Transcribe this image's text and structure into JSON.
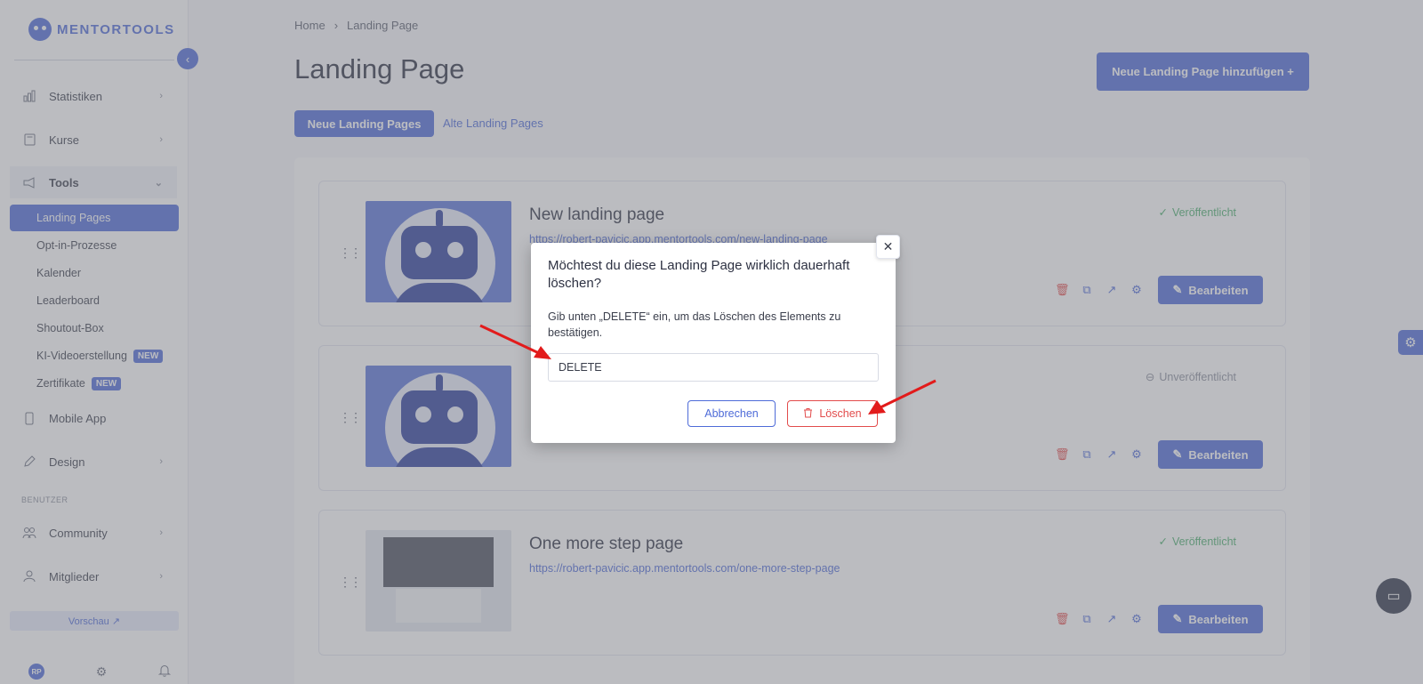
{
  "brand": {
    "name": "MENTORTOOLS"
  },
  "sidebar": {
    "items": [
      {
        "label": "Statistiken",
        "icon": "bar-chart-icon"
      },
      {
        "label": "Kurse",
        "icon": "book-icon"
      },
      {
        "label": "Tools",
        "icon": "megaphone-icon"
      },
      {
        "label": "Mobile App",
        "icon": "phone-icon"
      },
      {
        "label": "Design",
        "icon": "pencil-icon"
      },
      {
        "label": "Community",
        "icon": "people-icon"
      },
      {
        "label": "Mitglieder",
        "icon": "user-icon"
      }
    ],
    "sub_items": [
      {
        "label": "Landing Pages"
      },
      {
        "label": "Opt-in-Prozesse"
      },
      {
        "label": "Kalender"
      },
      {
        "label": "Leaderboard"
      },
      {
        "label": "Shoutout-Box"
      },
      {
        "label": "KI-Videoerstellung",
        "badge": "NEW"
      },
      {
        "label": "Zertifikate",
        "badge": "NEW"
      }
    ],
    "section_label": "BENUTZER",
    "preview_label": "Vorschau ↗",
    "avatar_initials": "RP"
  },
  "breadcrumb": {
    "home": "Home",
    "separator": "›",
    "current": "Landing Page"
  },
  "page": {
    "title": "Landing Page",
    "add_button": "Neue Landing Page hinzufügen  +",
    "tab_new": "Neue Landing Pages",
    "tab_old": "Alte Landing Pages"
  },
  "cards": [
    {
      "title": "New landing page",
      "url": "https://robert-pavicic.app.mentortools.com/new-landing-page",
      "status": "Veröffentlicht",
      "status_type": "published",
      "edit_label": "Bearbeiten"
    },
    {
      "title": "",
      "url": "",
      "status": "Unveröffentlicht",
      "status_type": "unpublished",
      "edit_label": "Bearbeiten"
    },
    {
      "title": "One more step page",
      "url": "https://robert-pavicic.app.mentortools.com/one-more-step-page",
      "status": "Veröffentlicht",
      "status_type": "published",
      "edit_label": "Bearbeiten"
    }
  ],
  "modal": {
    "title": "Möchtest du diese Landing Page wirklich dauerhaft löschen?",
    "description": "Gib unten „DELETE“ ein, um das Löschen des Elements zu bestätigen.",
    "input_value": "DELETE",
    "cancel_label": "Abbrechen",
    "delete_label": "Löschen"
  },
  "colors": {
    "accent": "#4e6bd8",
    "danger": "#e24b4b",
    "success": "#4caf6e",
    "annotation_arrow": "#e21b1b"
  }
}
